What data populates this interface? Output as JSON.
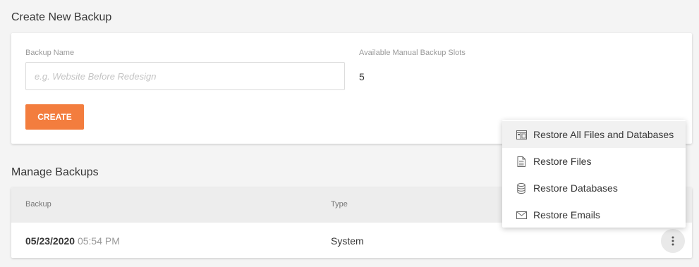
{
  "create": {
    "title": "Create New Backup",
    "name_label": "Backup Name",
    "name_placeholder": "e.g. Website Before Redesign",
    "name_value": "",
    "slots_label": "Available Manual Backup Slots",
    "slots_value": "5",
    "create_button": "CREATE"
  },
  "manage": {
    "title": "Manage Backups",
    "columns": [
      "Backup",
      "Type"
    ],
    "rows": [
      {
        "date": "05/23/2020",
        "time": "05:54 PM",
        "type": "System"
      }
    ]
  },
  "menu": {
    "items": [
      {
        "label": "Restore All Files and Databases",
        "icon": "layout-icon",
        "active": true
      },
      {
        "label": "Restore Files",
        "icon": "file-icon",
        "active": false
      },
      {
        "label": "Restore Databases",
        "icon": "database-icon",
        "active": false
      },
      {
        "label": "Restore Emails",
        "icon": "envelope-icon",
        "active": false
      }
    ]
  },
  "colors": {
    "accent": "#f37d3e",
    "background": "#f4f4f4",
    "table_header": "#ededed"
  }
}
